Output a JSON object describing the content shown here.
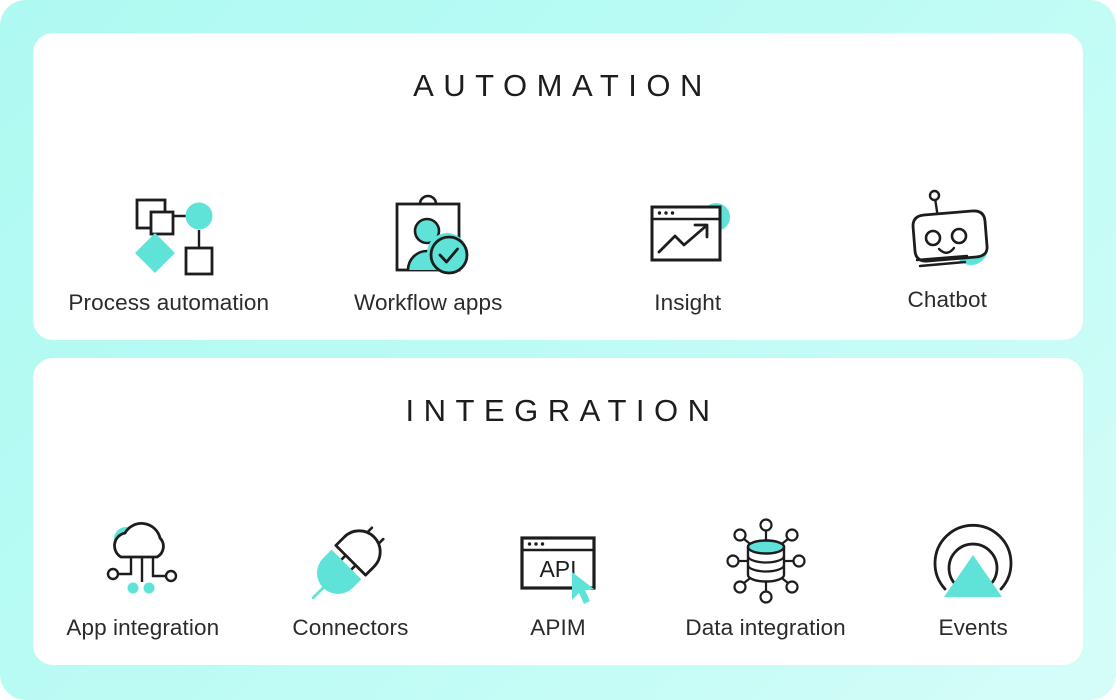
{
  "theme": {
    "background_gradient_from": "#aef9f2",
    "background_gradient_to": "#d6fdf8",
    "panel_background": "#ffffff",
    "accent": "#5fe3d8",
    "ink": "#1d1d1f",
    "label_ink": "#2b2b2e"
  },
  "panels": [
    {
      "id": "automation",
      "title": "AUTOMATION",
      "items": [
        {
          "label": "Process automation",
          "icon": "process-flow-icon"
        },
        {
          "label": "Workflow apps",
          "icon": "clipboard-person-check-icon"
        },
        {
          "label": "Insight",
          "icon": "browser-trend-chart-icon"
        },
        {
          "label": "Chatbot",
          "icon": "robot-head-icon"
        }
      ]
    },
    {
      "id": "integration",
      "title": "INTEGRATION",
      "items": [
        {
          "label": "App integration",
          "icon": "cloud-network-icon"
        },
        {
          "label": "Connectors",
          "icon": "plug-socket-icon"
        },
        {
          "label": "APIM",
          "icon": "browser-api-cursor-icon",
          "screen_text": "API"
        },
        {
          "label": "Data integration",
          "icon": "database-nodes-icon"
        },
        {
          "label": "Events",
          "icon": "broadcast-signal-icon"
        }
      ]
    }
  ]
}
